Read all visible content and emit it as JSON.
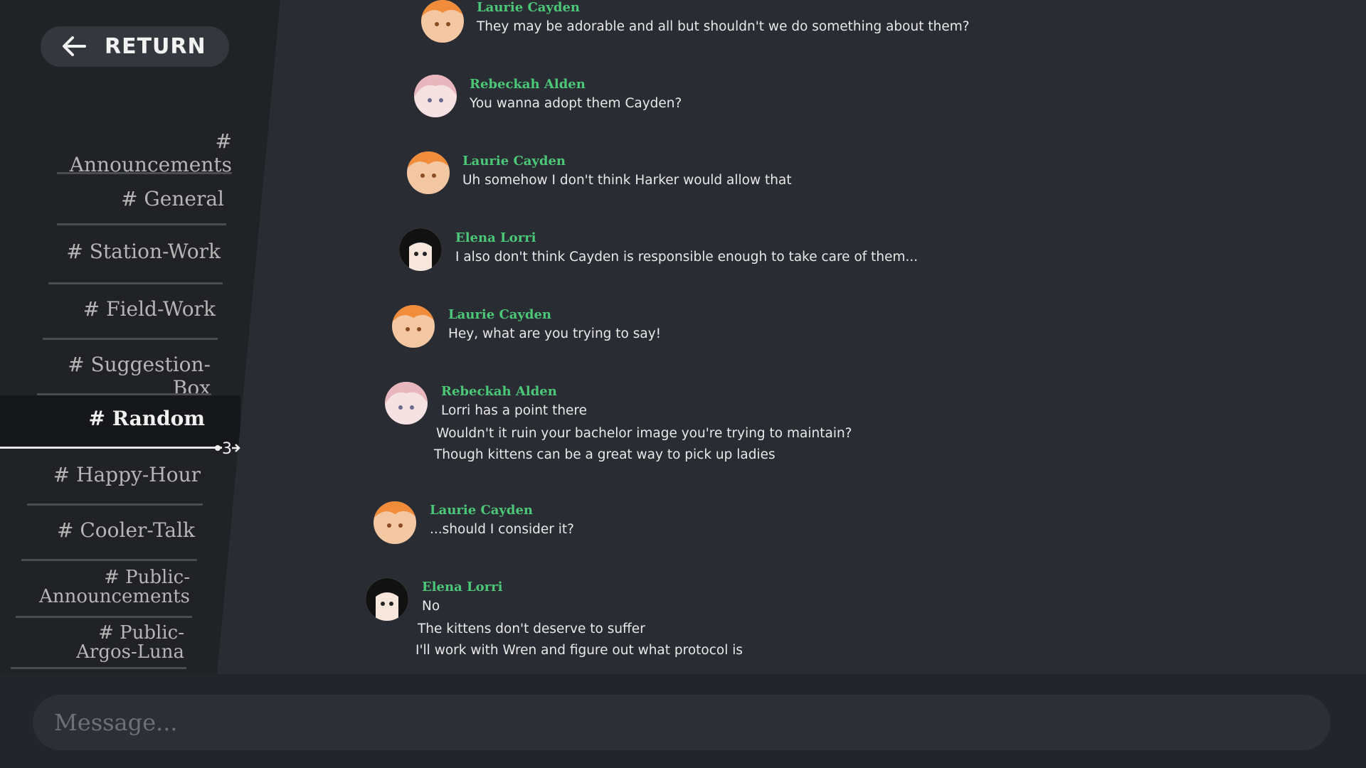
{
  "return_button": {
    "label": "RETURN",
    "icon": "arrow-left-icon"
  },
  "channels": [
    {
      "label": "# Announcements"
    },
    {
      "label": "# General"
    },
    {
      "label": "# Station-Work"
    },
    {
      "label": "# Field-Work"
    },
    {
      "label": "# Suggestion-Box"
    },
    {
      "label": "# Random",
      "active": true
    },
    {
      "label": "# Happy-Hour"
    },
    {
      "label": "# Cooler-Talk"
    },
    {
      "label_line1": "# Public-",
      "label_line2": "Announcements"
    },
    {
      "label_line1": "# Public-",
      "label_line2": "Argos-Luna"
    }
  ],
  "unread_indicator": "3",
  "messages": [
    {
      "author": "Laurie Cayden",
      "avatar": "orange-hair-avatar",
      "lines": [
        "They may be adorable and all but shouldn't we do something about them?"
      ]
    },
    {
      "author": "Rebeckah Alden",
      "avatar": "pink-hair-avatar",
      "lines": [
        "You wanna adopt them Cayden?"
      ]
    },
    {
      "author": "Laurie Cayden",
      "avatar": "orange-hair-avatar",
      "lines": [
        "Uh somehow I don't think Harker would allow that"
      ]
    },
    {
      "author": "Elena Lorri",
      "avatar": "black-hair-avatar",
      "lines": [
        "I also don't think Cayden is responsible enough to take care of them..."
      ]
    },
    {
      "author": "Laurie Cayden",
      "avatar": "orange-hair-avatar",
      "lines": [
        "Hey, what are you trying to say!"
      ]
    },
    {
      "author": "Rebeckah Alden",
      "avatar": "pink-hair-avatar",
      "lines": [
        "Lorri has a point there",
        "Wouldn't it ruin your bachelor image you're trying to maintain?",
        "Though kittens can be a great way to pick up ladies"
      ]
    },
    {
      "author": "Laurie Cayden",
      "avatar": "orange-hair-avatar",
      "lines": [
        "...should I consider it?"
      ]
    },
    {
      "author": "Elena Lorri",
      "avatar": "black-hair-avatar",
      "lines": [
        "No",
        "The kittens don't deserve to suffer",
        "I'll work with Wren and figure out what protocol is"
      ]
    }
  ],
  "message_input": {
    "placeholder": "Message..."
  },
  "colors": {
    "background": "#2a2c33",
    "sidebar": "#202226",
    "author_name": "#4cc777",
    "text": "#e8e8e8"
  }
}
